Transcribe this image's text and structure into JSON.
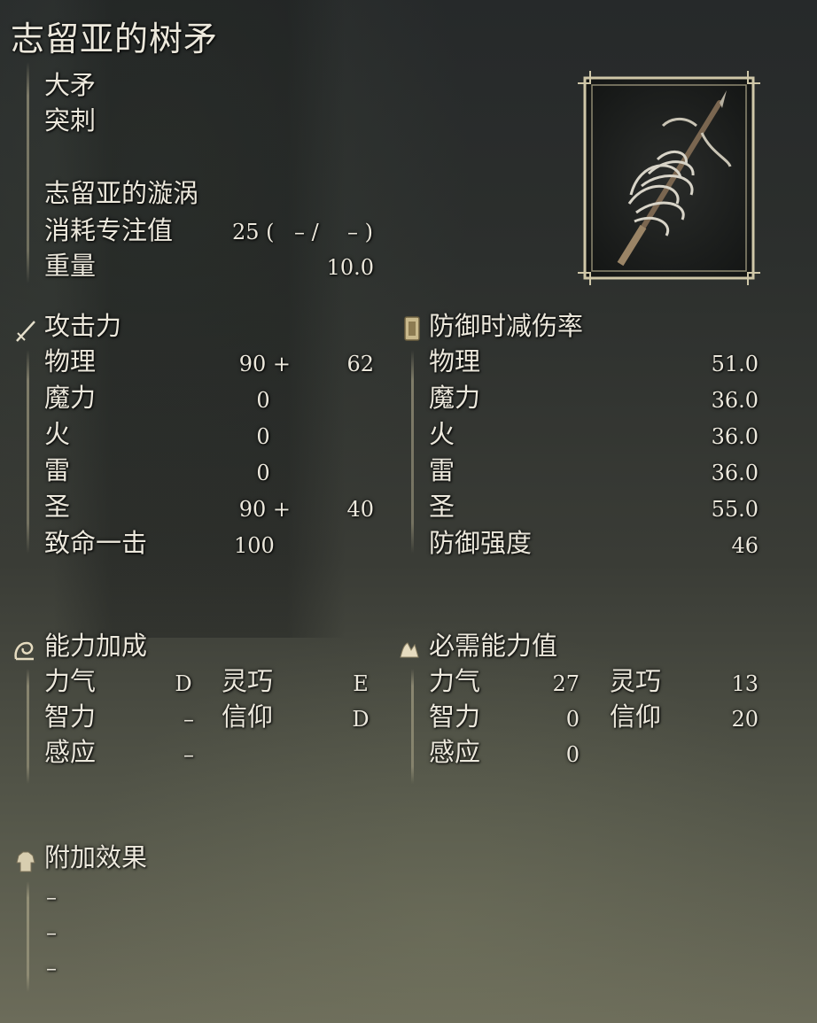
{
  "item": {
    "name": "志留亚的树矛",
    "weapon_type": "大矛",
    "attack_type": "突刺",
    "skill_name": "志留亚的漩涡",
    "fp_cost_label": "消耗专注值",
    "fp_cost_value": "25 (",
    "fp_cost_slash": "–  /",
    "fp_cost_end": "–  )",
    "weight_label": "重量",
    "weight_value": "10.0"
  },
  "attack": {
    "header": "攻击力",
    "rows": [
      {
        "label": "物理",
        "base": "90 +",
        "bonus": "62"
      },
      {
        "label": "魔力",
        "base": "0",
        "bonus": ""
      },
      {
        "label": "火",
        "base": "0",
        "bonus": ""
      },
      {
        "label": "雷",
        "base": "0",
        "bonus": ""
      },
      {
        "label": "圣",
        "base": "90 +",
        "bonus": "40"
      },
      {
        "label": "致命一击",
        "base": "100",
        "bonus": ""
      }
    ]
  },
  "guard": {
    "header": "防御时减伤率",
    "rows": [
      {
        "label": "物理",
        "value": "51.0"
      },
      {
        "label": "魔力",
        "value": "36.0"
      },
      {
        "label": "火",
        "value": "36.0"
      },
      {
        "label": "雷",
        "value": "36.0"
      },
      {
        "label": "圣",
        "value": "55.0"
      },
      {
        "label": "防御强度",
        "value": "46"
      }
    ]
  },
  "scaling": {
    "header": "能力加成",
    "rows": [
      {
        "l1": "力气",
        "v1": "D",
        "l2": "灵巧",
        "v2": "E"
      },
      {
        "l1": "智力",
        "v1": "–",
        "l2": "信仰",
        "v2": "D"
      },
      {
        "l1": "感应",
        "v1": "–",
        "l2": "",
        "v2": ""
      }
    ]
  },
  "requirements": {
    "header": "必需能力值",
    "rows": [
      {
        "l1": "力气",
        "v1": "27",
        "l2": "灵巧",
        "v2": "13"
      },
      {
        "l1": "智力",
        "v1": "0",
        "l2": "信仰",
        "v2": "20"
      },
      {
        "l1": "感应",
        "v1": "0",
        "l2": "",
        "v2": ""
      }
    ]
  },
  "effects": {
    "header": "附加效果",
    "items": [
      "–",
      "–",
      "–"
    ]
  },
  "icons": {
    "attack": "sword-icon",
    "guard": "shield-icon",
    "scaling": "arm-icon",
    "requirements": "hand-icon",
    "effects": "armor-icon",
    "weapon": "spear-image"
  },
  "colors": {
    "text": "#ece8dc",
    "frame": "#cfc7a8"
  }
}
